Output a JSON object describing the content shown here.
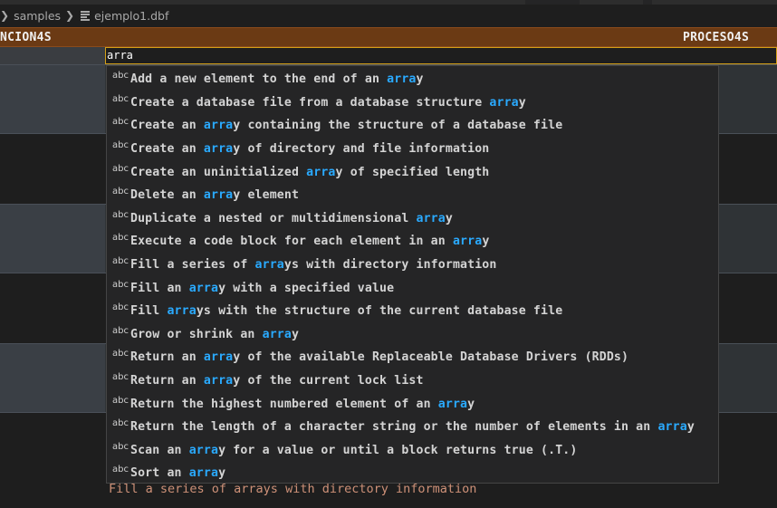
{
  "breadcrumb": {
    "folder": "samples",
    "file": "ejemplo1.dbf"
  },
  "table": {
    "header_left": "NCION4S",
    "header_right": "PROCESO4S"
  },
  "editor": {
    "input_value": "arra",
    "highlight_color": "#2aaaff",
    "input_border_color": "#d4a017"
  },
  "suggest": {
    "kind_label": "abc",
    "query": "arra",
    "items": [
      "Add a new element to the end of an array",
      "Create a database file from a database structure array",
      "Create an array containing the structure of a database file",
      "Create an array of directory and file information",
      "Create an uninitialized array of specified length",
      "Delete an array element",
      "Duplicate a nested or multidimensional array",
      "Execute a code block for each element in an array",
      "Fill a series of arrays with directory information",
      "Fill an array with a specified value",
      "Fill arrays with the structure of the current database file",
      "Grow or shrink an array",
      "Return an array of the available Replaceable Database Drivers (RDDs)",
      "Return an array of the current lock list",
      "Return the highest numbered element of an array",
      "Return the length of a character string or the number of elements in an array",
      "Scan an array for a value or until a block returns true (.T.)",
      "Sort an array"
    ]
  },
  "detail": {
    "text": "Fill a series of arrays with directory information"
  }
}
